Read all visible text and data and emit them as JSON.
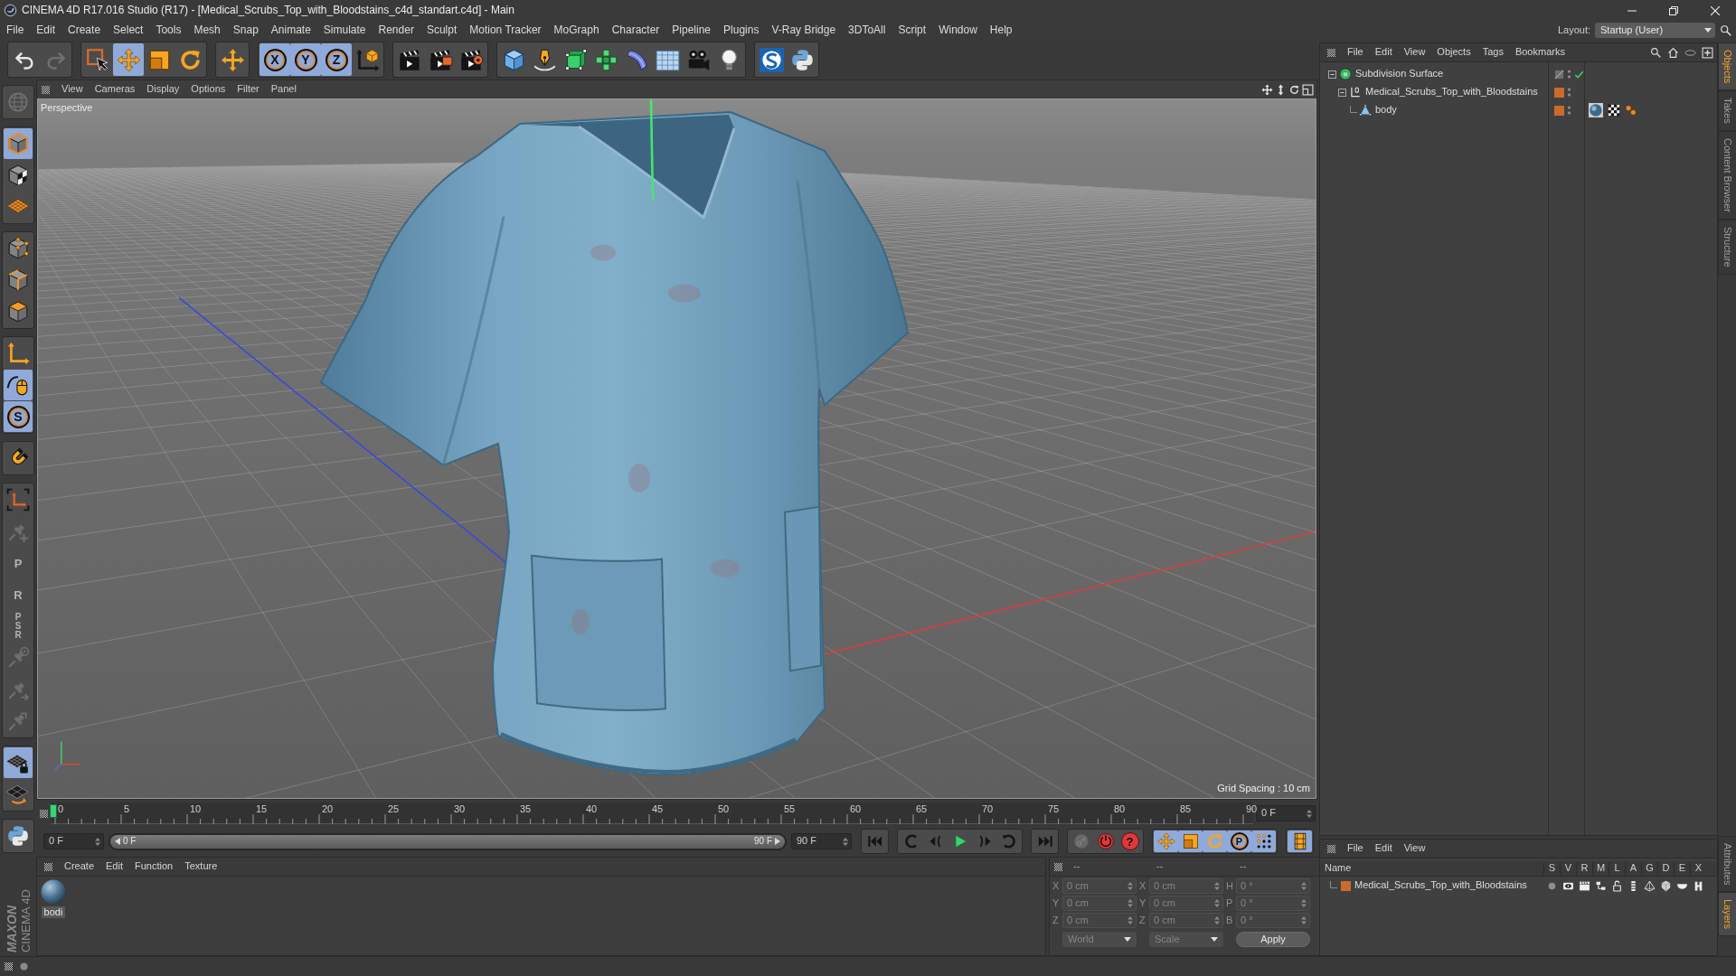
{
  "window": {
    "title": "CINEMA 4D R17.016 Studio (R17) - [Medical_Scrubs_Top_with_Bloodstains_c4d_standart.c4d] - Main"
  },
  "menu_bar": [
    "File",
    "Edit",
    "Create",
    "Select",
    "Tools",
    "Mesh",
    "Snap",
    "Animate",
    "Simulate",
    "Render",
    "Sculpt",
    "Motion Tracker",
    "MoGraph",
    "Character",
    "Pipeline",
    "Plugins",
    "V-Ray Bridge",
    "3DToAll",
    "Script",
    "Window",
    "Help"
  ],
  "layout": {
    "label": "Layout:",
    "value": "Startup (User)"
  },
  "toolbar": [
    [
      {
        "active": false,
        "disabled": false
      },
      {
        "active": false,
        "disabled": true
      }
    ],
    [
      {
        "active": false,
        "disabled": false
      },
      {
        "active": true,
        "disabled": false
      },
      {
        "active": false,
        "disabled": false
      },
      {
        "active": false,
        "disabled": false
      }
    ],
    [
      {
        "active": false,
        "disabled": false
      }
    ],
    [
      {
        "active": true,
        "disabled": false,
        "label": "X"
      },
      {
        "active": true,
        "disabled": false,
        "label": "Y"
      },
      {
        "active": true,
        "disabled": false,
        "label": "Z"
      },
      {
        "active": false,
        "disabled": false
      }
    ],
    [
      {
        "active": false,
        "disabled": false
      },
      {
        "active": false,
        "disabled": false
      },
      {
        "active": false,
        "disabled": false
      }
    ],
    [
      {
        "active": false,
        "disabled": false
      },
      {
        "active": false,
        "disabled": false
      },
      {
        "active": false,
        "disabled": false
      },
      {
        "active": false,
        "disabled": false
      },
      {
        "active": false,
        "disabled": false
      },
      {
        "active": false,
        "disabled": false
      },
      {
        "active": false,
        "disabled": false
      },
      {
        "active": false,
        "disabled": false
      }
    ],
    [
      {
        "active": false,
        "disabled": false
      },
      {
        "active": false,
        "disabled": false
      }
    ]
  ],
  "left_toolbar": [
    [
      {
        "active": false,
        "disabled": true
      }
    ],
    [
      {
        "active": true,
        "disabled": false
      },
      {
        "active": false,
        "disabled": false
      },
      {
        "active": false,
        "disabled": false
      }
    ],
    [
      {
        "active": false,
        "disabled": false
      },
      {
        "active": false,
        "disabled": false
      },
      {
        "active": false,
        "disabled": false
      }
    ],
    [
      {
        "active": false,
        "disabled": false
      },
      {
        "active": true,
        "disabled": false
      },
      {
        "active": true,
        "disabled": false,
        "label": "S"
      }
    ],
    [
      {
        "active": false,
        "disabled": false
      }
    ],
    [
      {
        "active": false,
        "disabled": false
      },
      {
        "active": false,
        "disabled": true
      },
      {
        "active": false,
        "disabled": true,
        "label": "P"
      },
      {
        "active": false,
        "disabled": true,
        "label": "R"
      },
      {
        "active": false,
        "disabled": true,
        "label": "PSR"
      },
      {
        "active": false,
        "disabled": true
      },
      {
        "active": false,
        "disabled": true
      },
      {
        "active": false,
        "disabled": true
      }
    ],
    [
      {
        "active": true,
        "disabled": false
      },
      {
        "active": false,
        "disabled": false
      }
    ],
    [
      {
        "active": false,
        "disabled": false
      }
    ]
  ],
  "viewport": {
    "menu": [
      "View",
      "Cameras",
      "Display",
      "Options",
      "Filter",
      "Panel"
    ],
    "camera": "Perspective",
    "grid_spacing": "Grid Spacing : 10 cm"
  },
  "object_manager": {
    "menu": [
      "File",
      "Edit",
      "View",
      "Objects",
      "Tags",
      "Bookmarks"
    ],
    "objects": [
      {
        "name": "Subdivision Surface",
        "kind": "generator",
        "expanded": true,
        "enabled": true,
        "children": [
          {
            "name": "Medical_Scrubs_Top_with_Bloodstains",
            "kind": "null",
            "expanded": true,
            "color": "#cc6a2c",
            "children": [
              {
                "name": "body",
                "kind": "polygon",
                "color": "#cc6a2c",
                "tags": [
                  {
                    "kind": "material"
                  },
                  {
                    "kind": "checker"
                  },
                  {
                    "kind": "dots"
                  }
                ]
              }
            ]
          }
        ]
      }
    ]
  },
  "side_tabs": {
    "top": [
      {
        "label": "Objects",
        "selected": true
      },
      {
        "label": "Takes",
        "selected": false
      },
      {
        "label": "Content Browser",
        "selected": false
      },
      {
        "label": "Structure",
        "selected": false
      }
    ],
    "bottom": [
      {
        "label": "Attributes",
        "selected": false
      },
      {
        "label": "Layers",
        "selected": true
      }
    ]
  },
  "timeline": {
    "ticks": [
      "0",
      "5",
      "10",
      "15",
      "20",
      "25",
      "30",
      "35",
      "40",
      "45",
      "50",
      "55",
      "60",
      "65",
      "70",
      "75",
      "80",
      "85",
      "90"
    ],
    "level": 0,
    "current_frame": "0 F"
  },
  "playback": {
    "start_frame": "0 F",
    "range": {
      "start": "0 F",
      "end": "90 F",
      "level": 1
    },
    "end_frame": "90 F",
    "buttons": [
      [
        {
          "active": false,
          "disabled": false
        }
      ],
      [
        {
          "active": false,
          "disabled": false
        },
        {
          "active": false,
          "disabled": false
        },
        {
          "active": false,
          "disabled": false
        },
        {
          "active": false,
          "disabled": false
        },
        {
          "active": false,
          "disabled": false
        }
      ],
      [
        {
          "active": false,
          "disabled": false
        }
      ],
      [
        {
          "active": false,
          "disabled": true
        },
        {
          "active": false,
          "disabled": false
        },
        {
          "active": false,
          "disabled": false,
          "label": "?"
        }
      ],
      [
        {
          "active": true,
          "disabled": false
        },
        {
          "active": true,
          "disabled": false
        },
        {
          "active": true,
          "disabled": false
        },
        {
          "active": true,
          "disabled": false,
          "label": "P"
        },
        {
          "active": true,
          "disabled": false
        }
      ],
      [
        {
          "active": true,
          "disabled": false
        }
      ]
    ]
  },
  "material_manager": {
    "menu": [
      "Create",
      "Edit",
      "Function",
      "Texture"
    ],
    "materials": [
      {
        "name": "bodi"
      }
    ]
  },
  "coordinates": {
    "disabled": true,
    "headers": [
      "--",
      "--",
      "--"
    ],
    "rows": [
      [
        {
          "label": "X",
          "value": "0 cm"
        },
        {
          "label": "X",
          "value": "0 cm"
        },
        {
          "label": "H",
          "value": "0 °"
        }
      ],
      [
        {
          "label": "Y",
          "value": "0 cm"
        },
        {
          "label": "Y",
          "value": "0 cm"
        },
        {
          "label": "P",
          "value": "0 °"
        }
      ],
      [
        {
          "label": "Z",
          "value": "0 cm"
        },
        {
          "label": "Z",
          "value": "0 cm"
        },
        {
          "label": "B",
          "value": "0 °"
        }
      ]
    ],
    "dropdowns": [
      "World",
      "Scale"
    ],
    "apply": "Apply"
  },
  "layer_manager": {
    "menu": [
      "File",
      "Edit",
      "View"
    ],
    "columns": [
      "Name",
      "S",
      "V",
      "R",
      "M",
      "L",
      "A",
      "G",
      "D",
      "E",
      "X"
    ],
    "layers": [
      {
        "name": "Medical_Scrubs_Top_with_Bloodstains",
        "color": "#cc6a2c",
        "switches": [
          {
            "on": false
          },
          {
            "on": true
          },
          {
            "on": true
          },
          {
            "on": true
          },
          {
            "on": false
          },
          {
            "on": true
          },
          {
            "on": true
          },
          {
            "on": true
          },
          {
            "on": true
          },
          {
            "on": true
          }
        ]
      }
    ]
  },
  "logo": {
    "brand": "MAXON",
    "product": "CINEMA 4D"
  }
}
